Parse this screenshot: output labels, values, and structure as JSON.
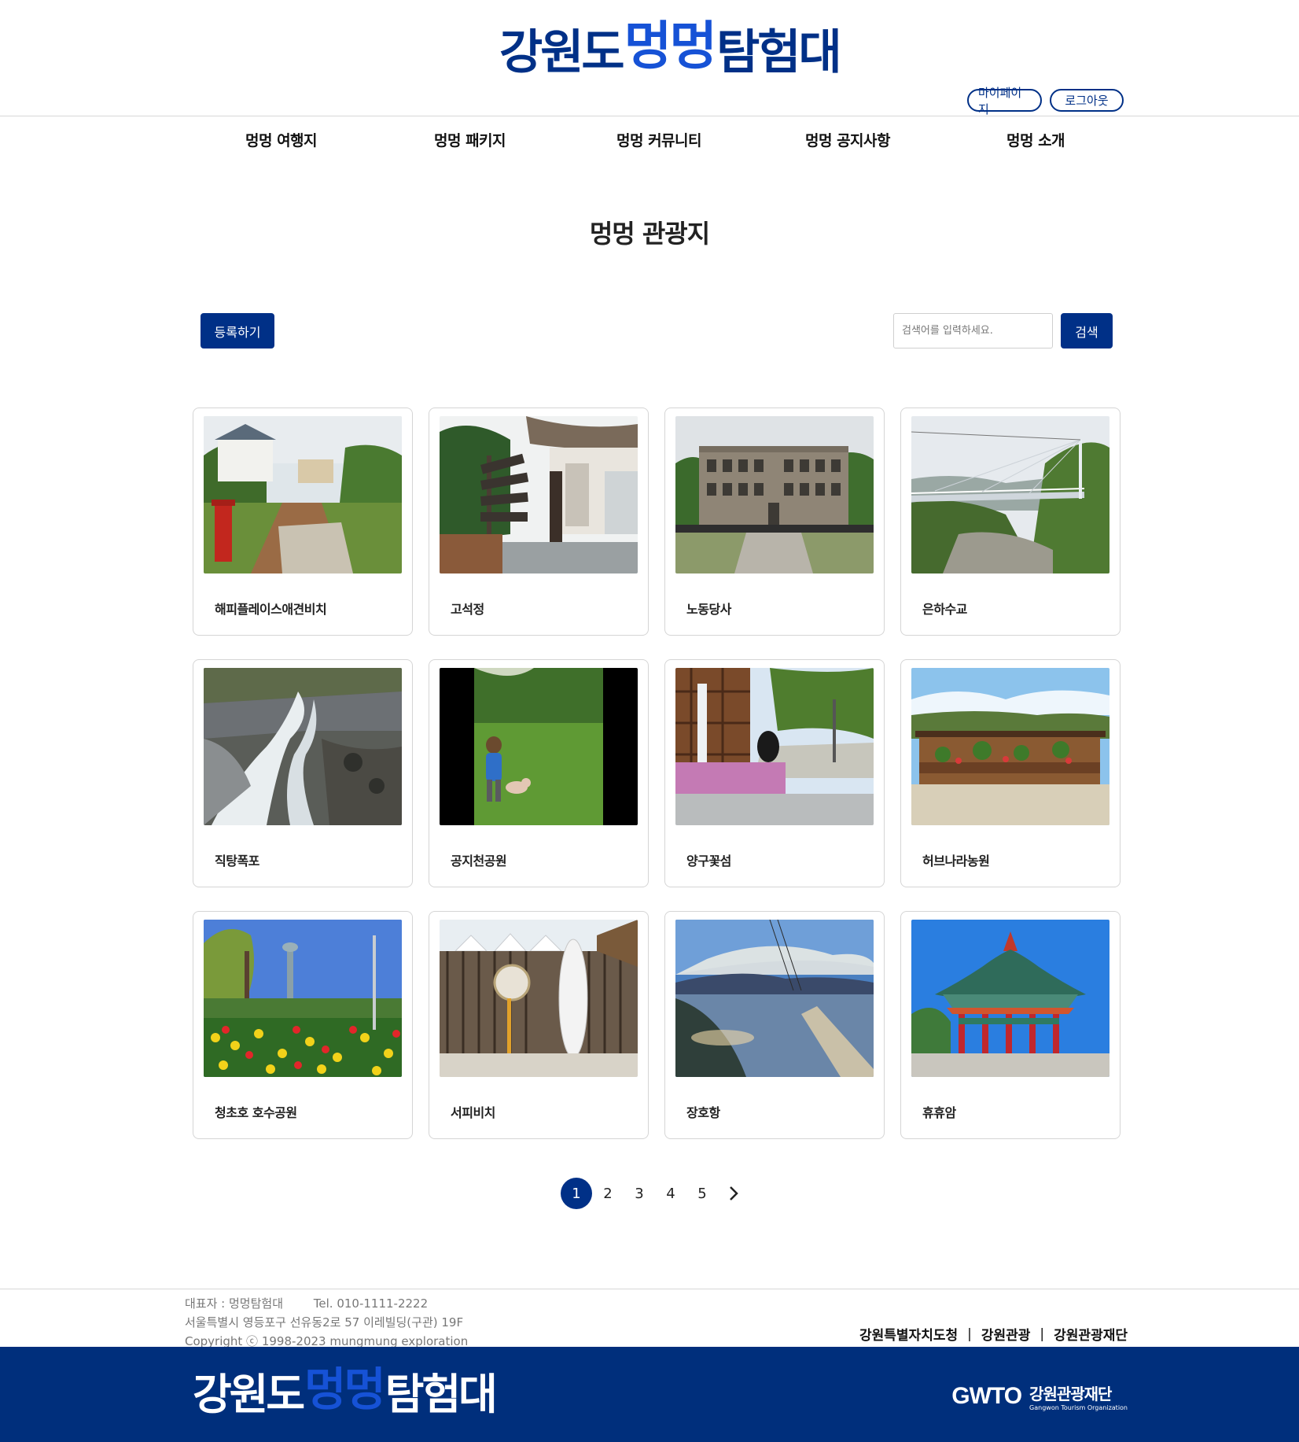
{
  "header": {
    "logo": {
      "part1": "강원도",
      "part2": "멍멍",
      "part3": "탐험대"
    },
    "mypage_label": "마이페이지",
    "logout_label": "로그아웃"
  },
  "nav": {
    "items": [
      {
        "label": "멍멍 여행지"
      },
      {
        "label": "멍멍 패키지"
      },
      {
        "label": "멍멍 커뮤니티"
      },
      {
        "label": "멍멍 공지사항"
      },
      {
        "label": "멍멍 소개"
      }
    ]
  },
  "page": {
    "title": "멍멍 관광지"
  },
  "toolbar": {
    "register_label": "등록하기",
    "search_placeholder": "검색어를 입력하세요.",
    "search_label": "검색"
  },
  "places": [
    {
      "name": "해피플레이스애견비치"
    },
    {
      "name": "고석정"
    },
    {
      "name": "노동당사"
    },
    {
      "name": "은하수교"
    },
    {
      "name": "직탕폭포"
    },
    {
      "name": "공지천공원"
    },
    {
      "name": "양구꽃섬"
    },
    {
      "name": "허브나라농원"
    },
    {
      "name": "청초호 호수공원"
    },
    {
      "name": "서피비치"
    },
    {
      "name": "장호항"
    },
    {
      "name": "휴휴암"
    }
  ],
  "pagination": {
    "pages": [
      "1",
      "2",
      "3",
      "4",
      "5"
    ],
    "current": "1"
  },
  "footer": {
    "representative": "대표자 : 멍멍탐험대",
    "tel": "Tel. 010-1111-2222",
    "address": "서울특별시 영등포구 선유동2로 57 이레빌딩(구관) 19F",
    "copyright": "Copyright ⓒ 1998-2023 mungmung exploration",
    "links": [
      "강원특별자치도청",
      "강원관광",
      "강원관광재단"
    ],
    "logo": {
      "part1": "강원도",
      "part2": "멍멍",
      "part3": "탐험대"
    },
    "partner": {
      "mark": "GWTO",
      "name_ko": "강원관광재단",
      "name_en": "Gangwon Tourism Organization"
    }
  },
  "colors": {
    "brand": "#003087",
    "accent": "#1652d6",
    "footer_bg": "#002f7c"
  }
}
